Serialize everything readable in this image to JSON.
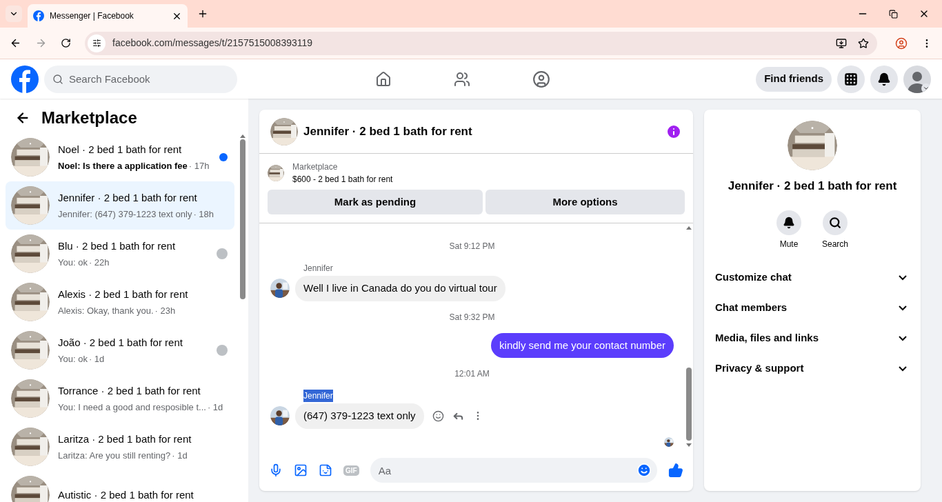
{
  "browser": {
    "tab_title": "Messenger | Facebook",
    "url": "facebook.com/messages/t/2157515008393119"
  },
  "facebook": {
    "search_placeholder": "Search Facebook",
    "find_friends": "Find friends"
  },
  "sidebar": {
    "title": "Marketplace",
    "conversations": [
      {
        "title": "Noel · 2 bed 1 bath for rent",
        "preview": "Noel: Is there a application fee",
        "time": "· 17h",
        "unread": true,
        "seen": false,
        "selected": false
      },
      {
        "title": "Jennifer · 2 bed 1 bath for rent",
        "preview": "Jennifer: (647) 379-1223 text only",
        "time": "· 18h",
        "unread": false,
        "seen": false,
        "selected": true
      },
      {
        "title": "Blu · 2 bed 1 bath for rent",
        "preview": "You: ok",
        "time": "· 22h",
        "unread": false,
        "seen": true,
        "selected": false
      },
      {
        "title": "Alexis · 2 bed 1 bath for rent",
        "preview": "Alexis: Okay, thank you.",
        "time": "· 23h",
        "unread": false,
        "seen": false,
        "selected": false
      },
      {
        "title": "João · 2 bed 1 bath for rent",
        "preview": "You: ok",
        "time": "· 1d",
        "unread": false,
        "seen": true,
        "selected": false
      },
      {
        "title": "Torrance · 2 bed 1 bath for rent",
        "preview": "You: I need a good and resposible t...",
        "time": "· 1d",
        "unread": false,
        "seen": false,
        "selected": false
      },
      {
        "title": "Laritza · 2 bed 1 bath for rent",
        "preview": "Laritza: Are you still renting?",
        "time": "· 1d",
        "unread": false,
        "seen": false,
        "selected": false
      },
      {
        "title": "Autistic · 2 bed 1 bath for rent",
        "unread": false,
        "seen": false,
        "selected": false
      }
    ]
  },
  "chat": {
    "title": "Jennifer · 2 bed 1 bath for rent",
    "listing": {
      "source": "Marketplace",
      "title": "$600 - 2 bed 1 bath for rent"
    },
    "buttons": [
      "Mark as pending",
      "More options"
    ],
    "messages": [
      {
        "kind": "time",
        "text": "Sat 9:12 PM"
      },
      {
        "kind": "incoming",
        "sender": "Jennifer",
        "sender_highlighted": false,
        "text": "Well I live in Canada do you do virtual tour",
        "actions": false
      },
      {
        "kind": "time",
        "text": "Sat 9:32 PM"
      },
      {
        "kind": "outgoing",
        "text": "kindly send me your contact number"
      },
      {
        "kind": "time",
        "text": "12:01 AM"
      },
      {
        "kind": "incoming",
        "sender": "Jennifer",
        "sender_highlighted": true,
        "text": "(647) 379-1223 text only",
        "actions": true
      }
    ],
    "composer": {
      "gif_label": "GIF",
      "placeholder": "Aa"
    }
  },
  "details": {
    "title": "Jennifer · 2 bed 1 bath for rent",
    "actions": [
      {
        "kind": "mute",
        "label": "Mute"
      },
      {
        "kind": "search",
        "label": "Search"
      }
    ],
    "sections": [
      {
        "label": "Customize chat",
        "expanded": false
      },
      {
        "label": "Chat members",
        "expanded": false
      },
      {
        "label": "Media, files and links",
        "expanded": false
      },
      {
        "label": "Privacy & support",
        "expanded": false
      }
    ]
  }
}
